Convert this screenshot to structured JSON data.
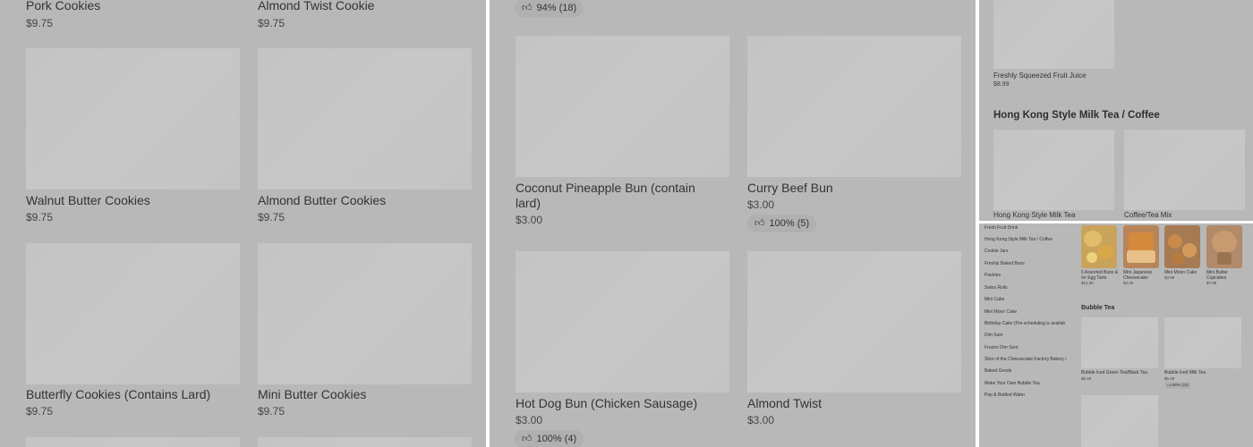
{
  "panel1": {
    "items": [
      {
        "name": "Pork Cookies",
        "price": "$9.75"
      },
      {
        "name": "Almond Twist Cookie",
        "price": "$9.75"
      },
      {
        "name": "Walnut Butter Cookies",
        "price": "$9.75"
      },
      {
        "name": "Almond Butter Cookies",
        "price": "$9.75"
      },
      {
        "name": "Butterfly Cookies (Contains Lard)",
        "price": "$9.75"
      },
      {
        "name": "Mini Butter Cookies",
        "price": "$9.75"
      }
    ]
  },
  "panel2": {
    "top_badge": "94% (18)",
    "items": [
      {
        "name": "Coconut Pineapple Bun (contain lard)",
        "price": "$3.00"
      },
      {
        "name": "Curry Beef Bun",
        "price": "$3.00",
        "badge": "100% (5)"
      },
      {
        "name": "Hot Dog Bun (Chicken Sausage)",
        "price": "$3.00",
        "badge": "100% (4)"
      },
      {
        "name": "Almond Twist",
        "price": "$3.00"
      }
    ]
  },
  "panel3": {
    "item": {
      "name": "Freshly Squeezed Fruit Juice",
      "price": "$8.99"
    },
    "section_title": "Hong Kong Style Milk Tea / Coffee",
    "items": [
      {
        "name": "Hong Kong Style Milk Tea"
      },
      {
        "name": "Coffee/Tea Mix"
      }
    ]
  },
  "panel4": {
    "nav": [
      "Fresh Fruit Drink",
      "Hong Kong Style Milk Tea / Coffee",
      "Cookie Jars",
      "Freshly Baked Buns",
      "Pastries",
      "Swiss Rolls",
      "Mini Cake",
      "Mini Moon Cake",
      "Birthday Cake (Pre-scheduling is availab",
      "Dim Sum",
      "Frozen Dim Sum",
      "Slice of the Cheesecake Factory Bakery i",
      "Baked Goods",
      "Make Your Own Bubble Tea",
      "Pop & Bottled Water"
    ],
    "top_items": [
      {
        "name": "6 Assorted Buns & /or Egg Tarts",
        "price": "$13.60"
      },
      {
        "name": "Mini Japanese Cheesecake",
        "price": "$4.25"
      },
      {
        "name": "Mini Moon Cake",
        "price": "$3.99"
      },
      {
        "name": "Mini Butter Cupcakes",
        "price": "$7.99"
      }
    ],
    "section_title": "Bubble Tea",
    "bubble_items": [
      {
        "name": "Bubble Iced Green Tea/Black Tea",
        "price": "$6.49"
      },
      {
        "name": "Bubble Iced Milk Tea",
        "price": "$6.49",
        "badge": "98% (23)"
      }
    ]
  },
  "colors": {
    "overlay": "#b8b8b8",
    "placeholder": "#c4c4c4",
    "badge": "#b0b0b0",
    "text": "#333333"
  },
  "icons": {
    "rating": "thumbs-up-icon"
  }
}
